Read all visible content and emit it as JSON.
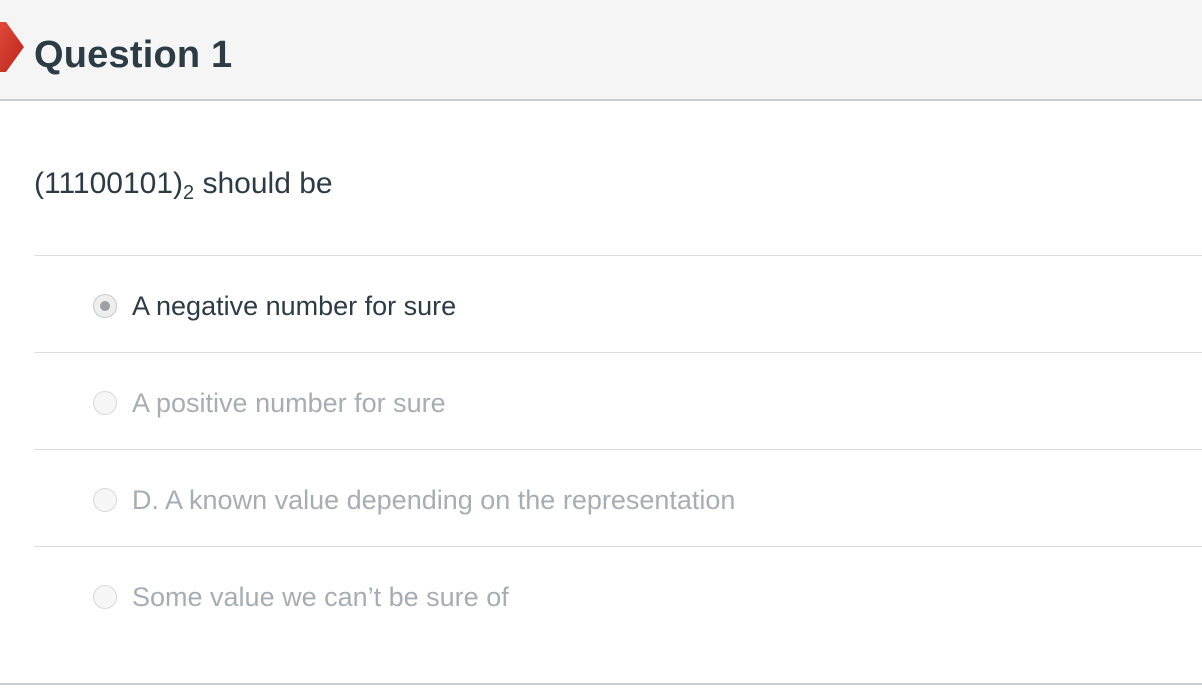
{
  "question": {
    "title": "Question 1",
    "status_icon": "flag-icon",
    "flag_color": "#d33a2c",
    "text_prefix": "(11100101)",
    "text_subscript": "2",
    "text_suffix": " should be"
  },
  "answers": [
    {
      "label": "A negative number for sure",
      "selected": true
    },
    {
      "label": "A positive number for sure",
      "selected": false
    },
    {
      "label": "D. A known value depending on the representation",
      "selected": false
    },
    {
      "label": "Some value we can’t be sure of",
      "selected": false
    }
  ]
}
